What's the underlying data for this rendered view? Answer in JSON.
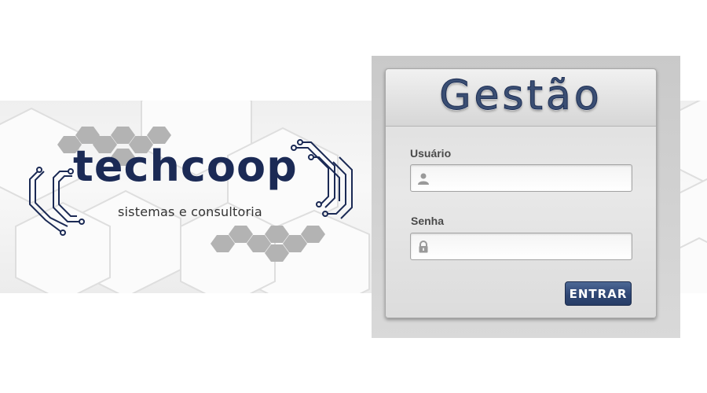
{
  "brand": {
    "name": "techcoop",
    "tagline": "sistemas e consultoria",
    "color": "#1b2a55",
    "hex_color": "#b3b3b3"
  },
  "login": {
    "title": "Gestão",
    "username_label": "Usuário",
    "username_value": "",
    "username_icon": "user-icon",
    "password_label": "Senha",
    "password_value": "",
    "password_icon": "lock-icon",
    "submit_label": "ENTRAR",
    "accent": "#2f4775"
  }
}
